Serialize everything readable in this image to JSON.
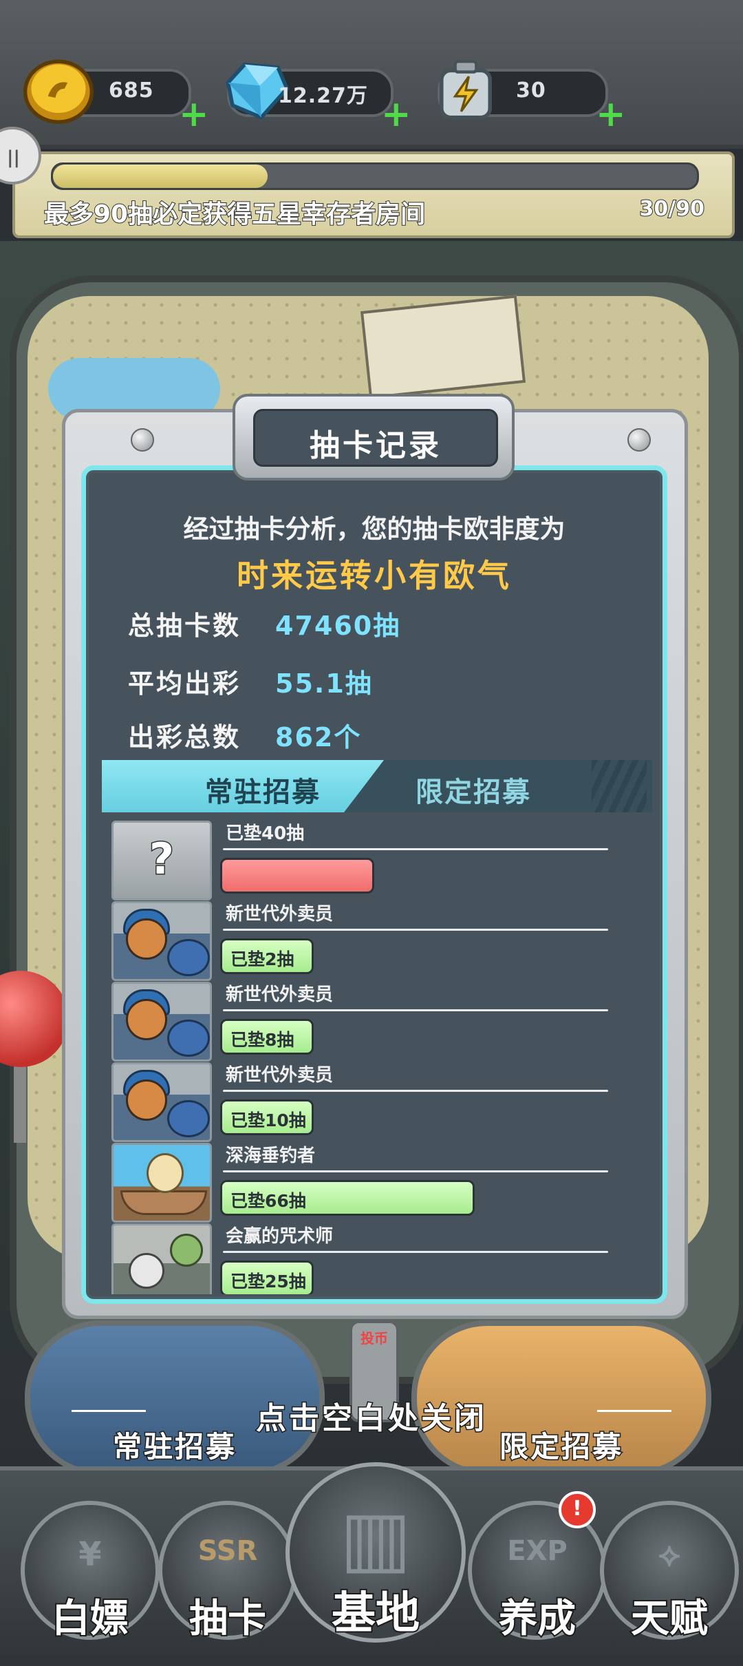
{
  "resources": [
    {
      "name": "coins",
      "icon": "coin-icon",
      "value": "685"
    },
    {
      "name": "diamonds",
      "icon": "diamond-icon",
      "value": "12.27万"
    },
    {
      "name": "energy",
      "icon": "battery-icon",
      "value": "30"
    }
  ],
  "pity": {
    "text": "最多90抽必定获得五星幸存者房间",
    "count": "30/90",
    "progress": 0.333
  },
  "modal": {
    "title": "抽卡记录",
    "analysis": "经过抽卡分析，您的抽卡欧非度为",
    "luck": "时来运转小有欧气",
    "stats": [
      {
        "label": "总抽卡数",
        "value": "47460抽"
      },
      {
        "label": "平均出彩",
        "value": "55.1抽"
      },
      {
        "label": "出彩总数",
        "value": "862个"
      }
    ],
    "tabs": [
      "常驻招募",
      "限定招募"
    ],
    "active_tab": "常驻招募",
    "records": [
      {
        "name": "已垫40抽",
        "pill": "",
        "kind": "unknown",
        "fill": 0.42,
        "color": "red",
        "thumb_text": "?"
      },
      {
        "name": "新世代外卖员",
        "pill": "已垫2抽",
        "kind": "shiba",
        "fill": 0.25,
        "color": "green"
      },
      {
        "name": "新世代外卖员",
        "pill": "已垫8抽",
        "kind": "shiba",
        "fill": 0.25,
        "color": "green"
      },
      {
        "name": "新世代外卖员",
        "pill": "已垫10抽",
        "kind": "shiba",
        "fill": 0.25,
        "color": "green"
      },
      {
        "name": "深海垂钓者",
        "pill": "已垫66抽",
        "kind": "fisher",
        "fill": 0.7,
        "color": "green"
      },
      {
        "name": "会赢的咒术师",
        "pill": "已垫25抽",
        "kind": "zombie",
        "fill": 0.25,
        "color": "green"
      }
    ]
  },
  "recruit": {
    "left": "常驻招募",
    "right": "限定招募",
    "slot": "投币"
  },
  "close_hint": "点击空白处关闭",
  "nav": [
    {
      "label": "白嫖",
      "glyph": "¥"
    },
    {
      "label": "抽卡",
      "glyph": "SSR"
    },
    {
      "label": "基地",
      "glyph": "▥"
    },
    {
      "label": "养成",
      "glyph": "EXP"
    },
    {
      "label": "天赋",
      "glyph": "⟡"
    }
  ],
  "badge": "!",
  "colors": {
    "accent": "#7ee7ee",
    "luck": "#ffc94a",
    "stat": "#7fe3ff",
    "plus": "#4fd94b"
  }
}
